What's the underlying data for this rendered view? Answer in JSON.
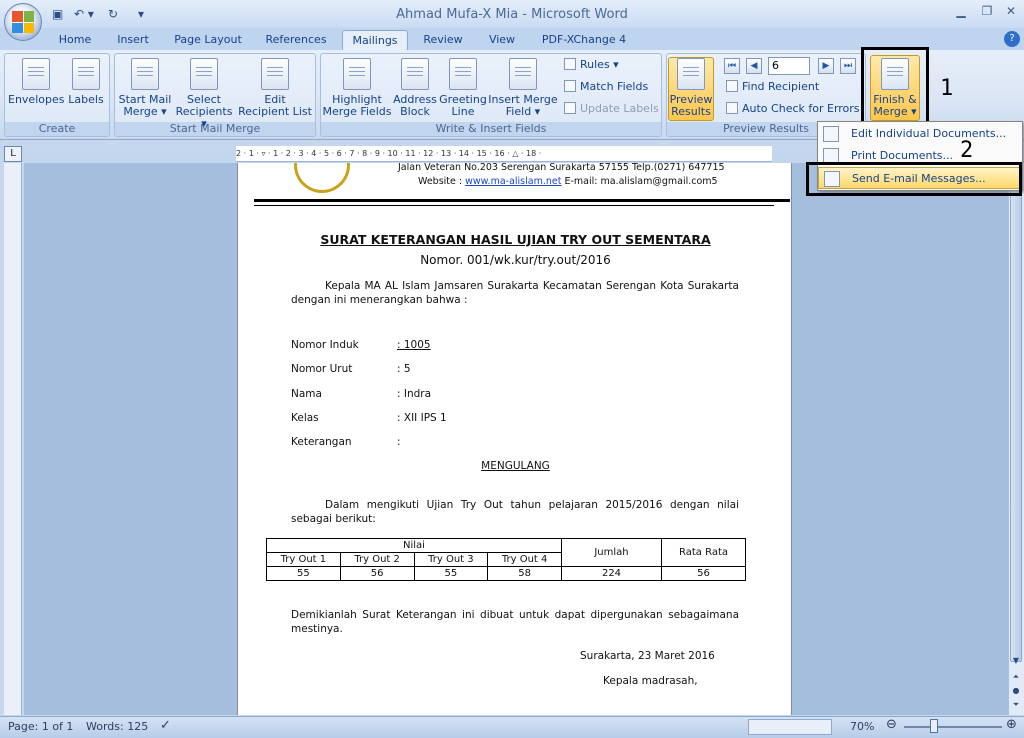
{
  "titlebar": {
    "title": "Ahmad Mufa-X Mia - Microsoft Word",
    "minimize": "▁",
    "restore": "❐",
    "close": "✕"
  },
  "tabs": [
    "Home",
    "Insert",
    "Page Layout",
    "References",
    "Mailings",
    "Review",
    "View",
    "PDF-XChange 4"
  ],
  "ribbon": {
    "create": {
      "label": "Create",
      "envelopes": "Envelopes",
      "labels": "Labels"
    },
    "start": {
      "label": "Start Mail Merge",
      "start_merge": [
        "Start Mail",
        "Merge ▾"
      ],
      "select": [
        "Select",
        "Recipients ▾"
      ],
      "edit": [
        "Edit",
        "Recipient List"
      ]
    },
    "write": {
      "label": "Write & Insert Fields",
      "highlight": [
        "Highlight",
        "Merge Fields"
      ],
      "address": [
        "Address",
        "Block"
      ],
      "greeting": [
        "Greeting",
        "Line"
      ],
      "insert": [
        "Insert Merge",
        "Field ▾"
      ],
      "rules": "Rules ▾",
      "match": "Match Fields",
      "update": "Update Labels"
    },
    "preview": {
      "label": "Preview Results",
      "preview": [
        "Preview",
        "Results"
      ],
      "record": "6",
      "find": "Find Recipient",
      "autocheck": "Auto Check for Errors"
    },
    "finish": {
      "finish": [
        "Finish &",
        "Merge ▾"
      ]
    }
  },
  "menu": {
    "edit": "Edit Individual Documents...",
    "print": "Print Documents...",
    "email": "Send E-mail Messages..."
  },
  "annotations": {
    "one": "1",
    "two": "2"
  },
  "ruler_marks": "2 · 1 · ▿ · 1 · 2 · 3 · 4 · 5 · 6 · 7 · 8 · 9 · 10 · 11 · 12 · 13 · 14 · 15 · 16 · △ · 18 ·",
  "doc": {
    "addr1": "Jalan Veteran No.203 Serengan Surakarta 57155 Telp.(0271) 647715",
    "web_label": "Website : ",
    "web": "www.ma-alislam.net",
    "email": " E-mail: ma.alislam@gmail.com5",
    "title": "SURAT KETERANGAN HASIL UJIAN TRY OUT SEMENTARA",
    "nomor": "Nomor.  001/wk.kur/try.out/2016",
    "intro": "Kepala MA AL Islam Jamsaren Surakarta Kecamatan Serengan Kota Surakarta dengan ini menerangkan bahwa :",
    "fields": [
      {
        "label": "Nomor Induk",
        "value": ": 1005"
      },
      {
        "label": "Nomor Urut",
        "value": ": 5"
      },
      {
        "label": "Nama",
        "value": ": Indra"
      },
      {
        "label": "Kelas",
        "value": ": XII IPS 1"
      },
      {
        "label": "Keterangan",
        "value": ":"
      }
    ],
    "status": "MENGULANG",
    "para2": "Dalam mengikuti Ujian Try Out tahun pelajaran 2015/2016 dengan nilai sebagai berikut:",
    "table": {
      "nilai": "Nilai",
      "jumlah": "Jumlah",
      "rata": "Rata Rata",
      "heads": [
        "Try Out 1",
        "Try Out 2",
        "Try Out 3",
        "Try Out 4"
      ],
      "values": [
        "55",
        "56",
        "55",
        "58"
      ],
      "sum": "224",
      "avg": "56"
    },
    "closing": "Demikianlah Surat Keterangan ini dibuat untuk dapat dipergunakan sebagaimana mestinya.",
    "place_date": "Surakarta, 23 Maret 2016",
    "sign": "Kepala madrasah,"
  },
  "statusbar": {
    "page": "Page: 1 of 1",
    "words": "Words: 125",
    "zoom": "70%"
  }
}
